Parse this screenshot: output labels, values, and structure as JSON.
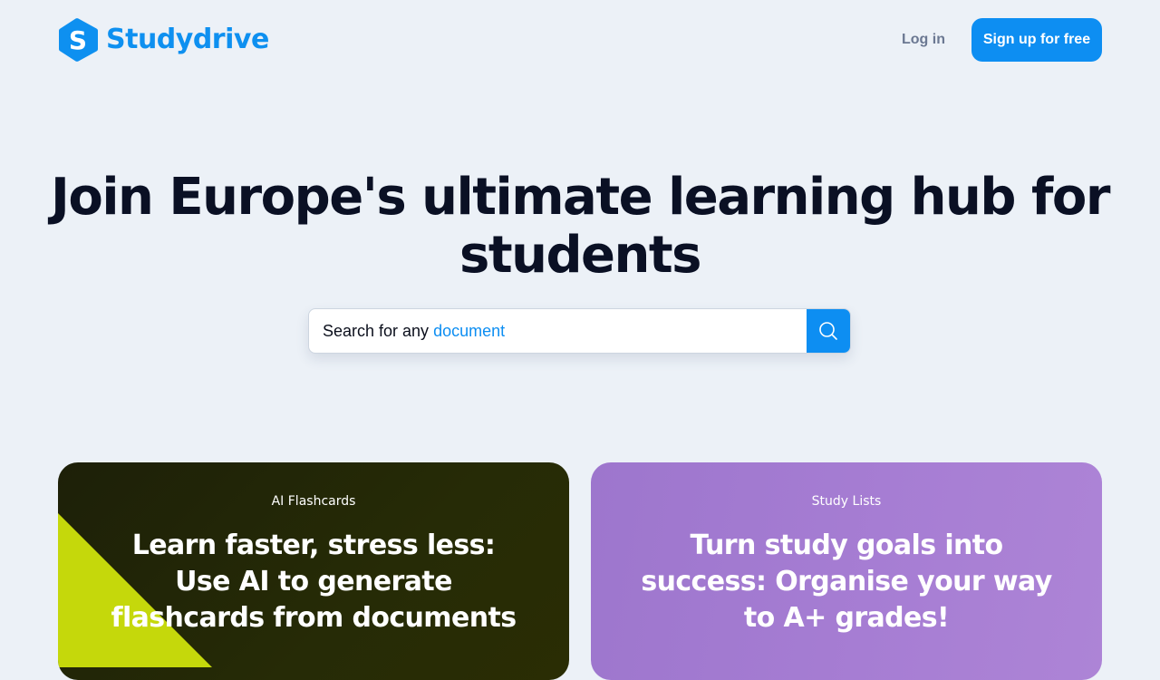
{
  "brand": {
    "name": "Studydrive",
    "logo_letter": "S",
    "color": "#0e90f0"
  },
  "nav": {
    "login_label": "Log in",
    "signup_label": "Sign up for free"
  },
  "hero": {
    "title_lines": [
      "Join Europe's ultimate learning hub for",
      "students"
    ]
  },
  "search": {
    "prefix": "Search for any",
    "highlight": "document",
    "icon": "search-icon"
  },
  "cards": [
    {
      "label": "AI Flashcards",
      "heading_lines": [
        "Learn faster, stress less:",
        "Use AI to generate",
        "flashcards from documents"
      ],
      "accent": "#c5d80b"
    },
    {
      "label": "Study Lists",
      "heading_lines": [
        "Turn study goals into",
        "success: Organise your way",
        "to A+ grades!"
      ]
    }
  ],
  "colors": {
    "background": "#ecf1f7",
    "primary": "#0d8ef2",
    "heading": "#0a1024"
  }
}
